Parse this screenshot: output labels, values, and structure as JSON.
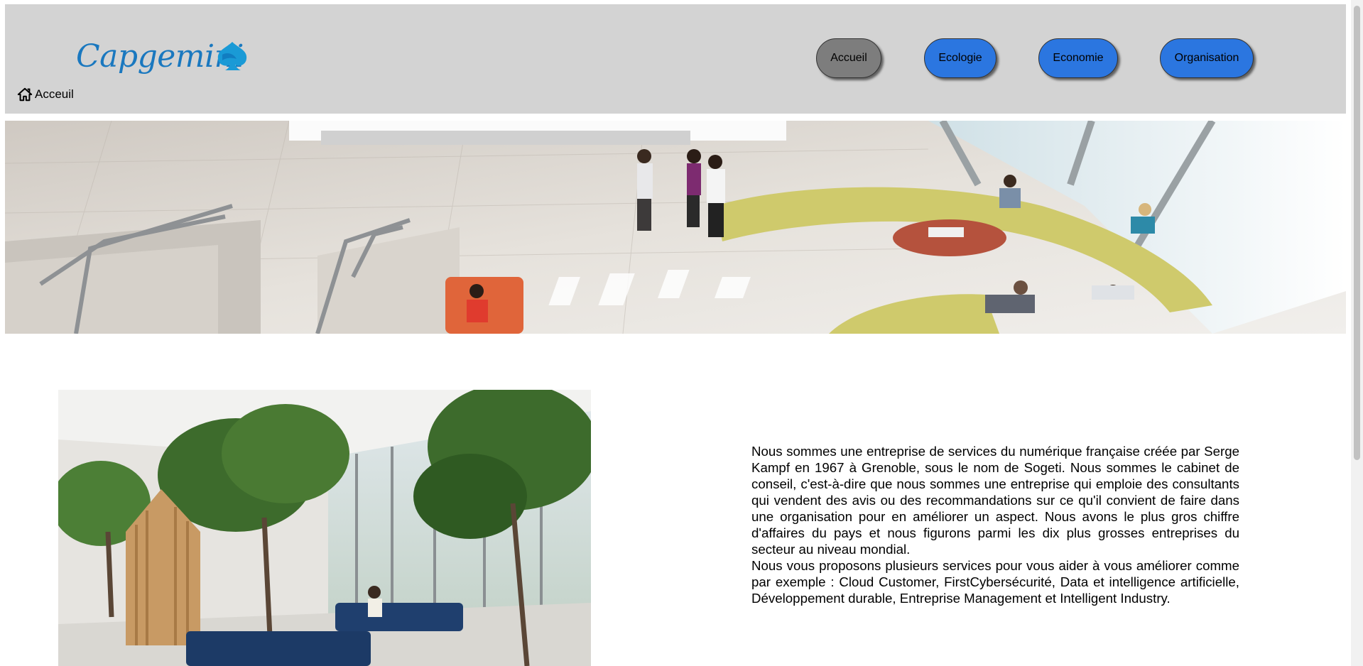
{
  "header": {
    "logo_text": "Capgemini",
    "breadcrumb_label": "Acceuil",
    "nav": [
      {
        "label": "Accueil",
        "active": true
      },
      {
        "label": "Ecologie",
        "active": false
      },
      {
        "label": "Economie",
        "active": false
      },
      {
        "label": "Organisation",
        "active": false
      }
    ]
  },
  "content": {
    "paragraph1": "Nous sommes une entreprise de services du numérique française créée par Serge Kampf en 1967 à Grenoble, sous le nom de Sogeti. Nous sommes le cabinet de conseil, c'est-à-dire que nous sommes une entreprise qui emploie des consultants qui vendent des avis ou des recommandations sur ce qu'il convient de faire dans une organisation pour en améliorer un aspect. Nous avons le plus gros chiffre d'affaires du pays et nous figurons parmi les dix plus grosses entreprises du secteur au niveau mondial.",
    "paragraph2": "Nous vous proposons plusieurs services pour vous aider à vous améliorer comme par exemple : Cloud Customer, FirstCybersécurité, Data et intelligence artificielle, Développement durable, Entreprise Management et Intelligent Industry."
  },
  "colors": {
    "header_bg": "#d3d3d3",
    "nav_active": "#7d7d7d",
    "nav_blue": "#2b76e0",
    "logo_blue": "#1a78bf"
  },
  "icons": {
    "home": "home-icon",
    "logo_mark": "spade-icon"
  }
}
